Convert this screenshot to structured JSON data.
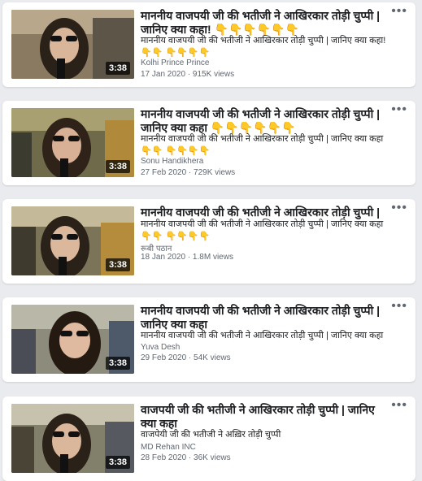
{
  "videos": [
    {
      "title": "माननीय वाजपयी जी की भतीजी ने आखिरकार तोड़ी चुप्पी | जानिए क्या कहा! 👇👇👇👇👇👇",
      "description": "माननीय वाजपयी जी की भतीजी ने आखिरकार तोड़ी चुप्पी | जानिए क्या कहा! 👇👇 👇👇👇👇",
      "channel": "Kolhi Prince Prince",
      "meta": "17 Jan 2020 · 915K views",
      "duration": "3:38"
    },
    {
      "title": "माननीय वाजपयी जी की भतीजी ने आखिरकार तोड़ी चुप्पी | जानिए क्या कहा 👇👇👇👇👇👇",
      "description": "माननीय वाजपयी जी की भतीजी ने आखिरकार तोड़ी चुप्पी | जानिए क्या कहा 👇👇 👇👇👇👇",
      "channel": "Sonu Handikhera",
      "meta": "27 Feb 2020 · 729K views",
      "duration": "3:38"
    },
    {
      "title": "माननीय वाजपयी जी की भतीजी ने आखिरकार तोड़ी चुप्पी |",
      "description": "माननीय वाजपयी जी की भतीजी ने आखिरकार तोड़ी चुप्पी | जानिए क्या कहा 👇👇 👇👇👇👇",
      "channel": "रूबी पठान",
      "meta": "18 Jan 2020 · 1.8M views",
      "duration": "3:38"
    },
    {
      "title": "माननीय वाजपयी जी की भतीजी ने आखिरकार तोड़ी चुप्पी | जानिए क्या कहा",
      "description": "माननीय वाजपयी जी की भतीजी ने आखिरकार तोड़ी चुप्पी | जानिए क्या कहा",
      "channel": "Yuva Desh",
      "meta": "29 Feb 2020 · 54K views",
      "duration": "3:38"
    },
    {
      "title": "वाजपयी जी की भतीजी ने आखिरकार तोड़ी चुप्पी | जानिए क्या कहा",
      "description": "वाजपेयी जी की भतीजी ने अख़िर तोड़ी चुप्पी",
      "channel": "MD Rehan INC",
      "meta": "28 Feb 2020 · 36K views",
      "duration": "3:38"
    }
  ],
  "more_icon": "more-options-icon",
  "colors": {
    "background": "#e9ebee",
    "card": "#ffffff",
    "text": "#1c1e21",
    "secondary": "#606770"
  }
}
